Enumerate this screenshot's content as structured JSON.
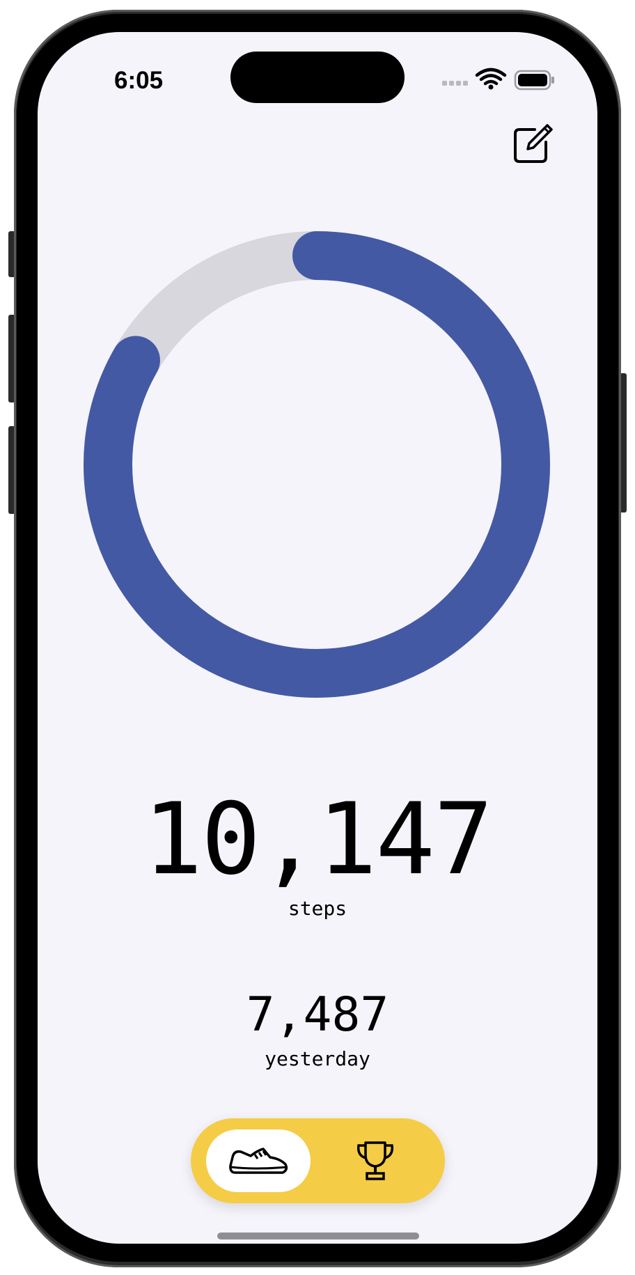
{
  "status_bar": {
    "time": "6:05",
    "wifi_icon": "wifi-icon",
    "battery_icon": "battery-icon",
    "signal_icon": "cellular-signal-icon"
  },
  "toolbar": {
    "edit_icon": "square-and-pencil-icon"
  },
  "progress": {
    "fraction": 0.833,
    "progress_color": "#4459a4",
    "track_color": "#d8d7de"
  },
  "today": {
    "steps": "10,147",
    "caption": "steps"
  },
  "yesterday": {
    "steps": "7,487",
    "caption": "yesterday"
  },
  "tabbar": {
    "background": "#f5cc45",
    "tabs": [
      {
        "icon": "shoe-icon",
        "selected": true
      },
      {
        "icon": "trophy-icon",
        "selected": false
      }
    ]
  }
}
